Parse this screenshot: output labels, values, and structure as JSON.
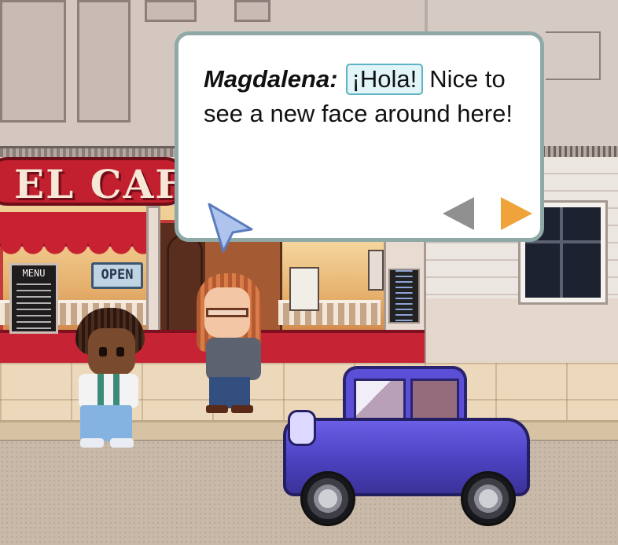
{
  "scene": {
    "cafe_sign_text": "EL CAF",
    "menu_board_title": "MENU",
    "open_sign_text": "OPEN"
  },
  "dialog": {
    "speaker": "Magdalena:",
    "highlighted_term": "¡Hola!",
    "line": "Nice to see a new face around here!",
    "prev_icon": "triangle-left-icon",
    "next_icon": "triangle-right-icon",
    "prev_color": "#909090",
    "next_color": "#f0a33a",
    "border_color": "#8fa9a7",
    "term_highlight_color": "#5cb3c2"
  },
  "characters": [
    {
      "name": "kid",
      "role": "player"
    },
    {
      "name": "Magdalena",
      "role": "npc"
    }
  ],
  "vehicle": {
    "type": "car",
    "color": "#5a4fd6"
  }
}
